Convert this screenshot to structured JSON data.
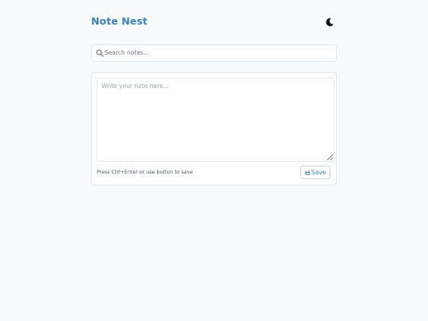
{
  "app": {
    "title": "Note Nest"
  },
  "header": {
    "theme_toggle_icon": "moon-icon"
  },
  "search": {
    "placeholder": "Search notes...",
    "value": "",
    "icon": "search-icon"
  },
  "editor": {
    "placeholder": "Write your note here...",
    "value": "",
    "hint": "Press Ctrl+Enter or use button to save"
  },
  "save_button": {
    "label": "Save",
    "icon": "floppy-disk-icon"
  },
  "colors": {
    "accent": "#3b82c4",
    "background": "#f8fafc",
    "border": "#e2e8f0"
  }
}
